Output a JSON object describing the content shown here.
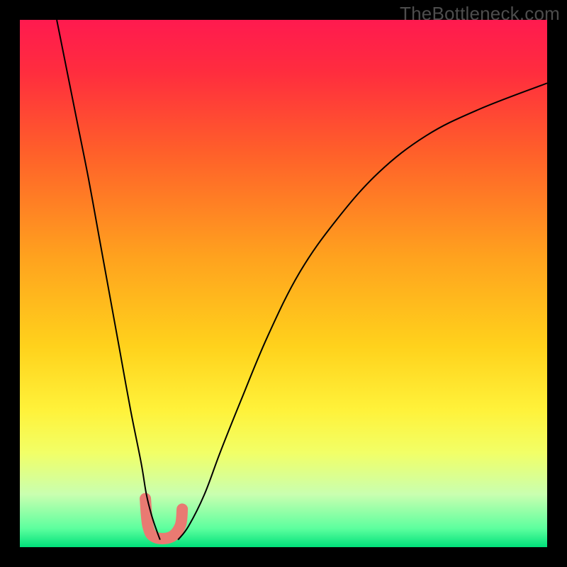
{
  "watermark": "TheBottleneck.com",
  "chart_data": {
    "type": "line",
    "title": "",
    "xlabel": "",
    "ylabel": "",
    "xlim": [
      0,
      100
    ],
    "ylim": [
      0,
      100
    ],
    "grid": false,
    "legend": false,
    "gradient_stops": [
      {
        "pos": 0.0,
        "color": "#ff1a4f"
      },
      {
        "pos": 0.1,
        "color": "#ff2d3e"
      },
      {
        "pos": 0.25,
        "color": "#ff5f2a"
      },
      {
        "pos": 0.45,
        "color": "#ffa21e"
      },
      {
        "pos": 0.62,
        "color": "#ffd21c"
      },
      {
        "pos": 0.74,
        "color": "#fff23a"
      },
      {
        "pos": 0.82,
        "color": "#f2ff66"
      },
      {
        "pos": 0.9,
        "color": "#c9ffb0"
      },
      {
        "pos": 0.965,
        "color": "#5cff9e"
      },
      {
        "pos": 1.0,
        "color": "#00e07a"
      }
    ],
    "series": [
      {
        "name": "left-branch",
        "x": [
          7,
          9,
          11,
          13,
          15,
          17,
          19,
          21,
          23,
          24,
          25,
          26,
          26.6
        ],
        "y": [
          100,
          90,
          80,
          70,
          59,
          48,
          37,
          26,
          16,
          10,
          6,
          3,
          1.4
        ]
      },
      {
        "name": "right-branch",
        "x": [
          30,
          32,
          35,
          38,
          42,
          47,
          53,
          60,
          68,
          77,
          87,
          100
        ],
        "y": [
          1.4,
          4,
          10,
          18,
          28,
          40,
          52,
          62,
          71,
          78,
          83,
          88
        ]
      }
    ],
    "minimum_marker": {
      "shape": "rounded-u",
      "approx_points": [
        {
          "x": 23.8,
          "y": 9.2
        },
        {
          "x": 24.3,
          "y": 4.0
        },
        {
          "x": 25.6,
          "y": 1.9
        },
        {
          "x": 28.6,
          "y": 1.9
        },
        {
          "x": 30.4,
          "y": 4.0
        },
        {
          "x": 30.8,
          "y": 7.2
        }
      ],
      "color": "#e97a72",
      "stroke_width_px": 16
    }
  }
}
